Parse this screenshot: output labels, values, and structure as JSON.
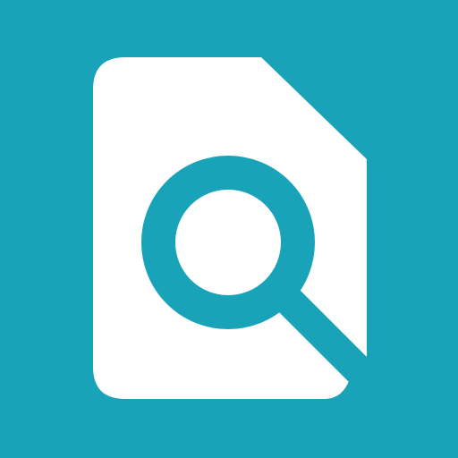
{
  "icon": {
    "name": "file-search-icon",
    "background_color": "#18A3B8",
    "document_color": "#FFFFFF",
    "magnifier_color": "#18A3B8"
  }
}
